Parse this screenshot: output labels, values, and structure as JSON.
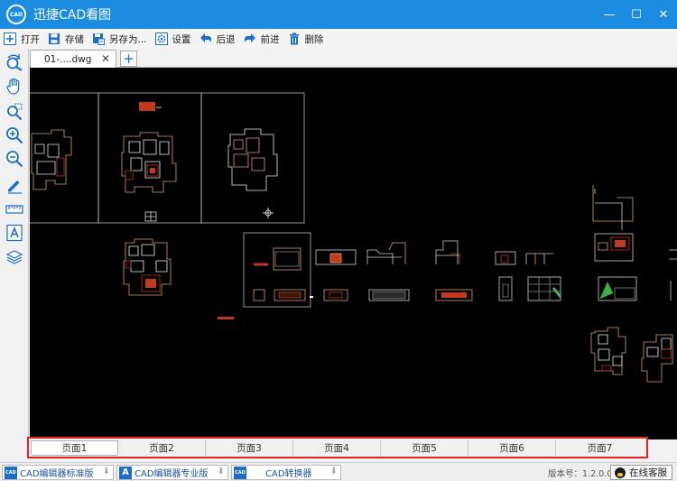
{
  "window": {
    "logo_text": "CAD",
    "title": "迅捷CAD看图",
    "minimize": "—",
    "maximize": "☐",
    "close": "✕"
  },
  "toolbar": {
    "open": "打开",
    "save": "存储",
    "save_as": "另存为...",
    "settings": "设置",
    "back": "后退",
    "forward": "前进",
    "delete": "删除"
  },
  "tabs": {
    "document": "01-....dwg",
    "close": "✕",
    "add": "+"
  },
  "palette": [
    "rotate-view-icon",
    "pan-hand-icon",
    "zoom-window-icon",
    "zoom-in-icon",
    "zoom-out-icon",
    "pencil-icon",
    "measure-icon",
    "text-icon",
    "layers-icon"
  ],
  "layouts": {
    "pages": [
      "页面1",
      "页面2",
      "页面3",
      "页面4",
      "页面5",
      "页面6",
      "页面7"
    ],
    "active_index": 0
  },
  "statusbar": {
    "apps": [
      {
        "label": "CAD编辑器标准版",
        "logo": "CAD"
      },
      {
        "label": "CAD编辑器专业版",
        "logo": "A"
      },
      {
        "label": "CAD转换器",
        "logo": "CAD"
      }
    ],
    "download_icon": "⬇",
    "version": "版本号：1.2.0.0",
    "service": "在线客服"
  },
  "colors": {
    "titlebar": "#1b8ce0",
    "canvas": "#000000",
    "highlight_border": "#e02424",
    "icon_blue": "#1b6fc8",
    "drawing_orange": "#d2693a",
    "drawing_red": "#c1391f"
  }
}
